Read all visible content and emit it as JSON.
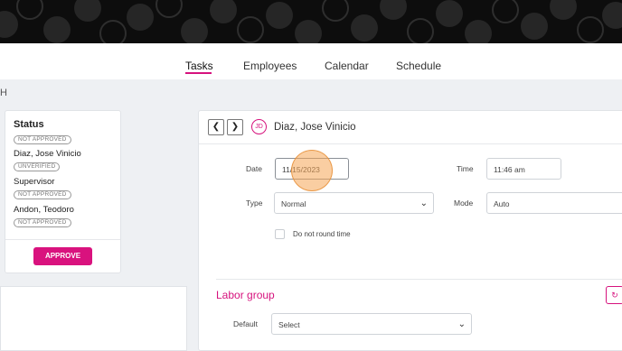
{
  "nav": {
    "tabs": [
      "Tasks",
      "Employees",
      "Calendar",
      "Schedule"
    ],
    "active": "Tasks"
  },
  "breadcrumb": "H",
  "status_card": {
    "title": "Status",
    "overall_badge": "NOT APPROVED",
    "people": [
      {
        "name": "Diaz, Jose Vinicio",
        "badge": "UNVERIFIED"
      },
      {
        "name": "Supervisor",
        "badge": "NOT APPROVED"
      },
      {
        "name": "Andon, Teodoro",
        "badge": "NOT APPROVED"
      }
    ],
    "approve_label": "APPROVE",
    "accent_color": "#d9127e"
  },
  "left_lower": {
    "text": "  "
  },
  "header": {
    "prev_icon": "chevron-left-icon",
    "next_icon": "chevron-right-icon",
    "avatar_initials": "JD",
    "employee_name": "Diaz, Jose Vinicio"
  },
  "form": {
    "date_label": "Date",
    "date_value": "11/15/2023",
    "time_label": "Time",
    "time_value": "11:46 am",
    "type_label": "Type",
    "type_value": "Normal",
    "mode_label": "Mode",
    "mode_value": "Auto",
    "round_label": "Do not round time"
  },
  "labor": {
    "title": "Labor group",
    "default_label": "Default",
    "default_value": "Select",
    "refresh_icon": "refresh-icon"
  }
}
